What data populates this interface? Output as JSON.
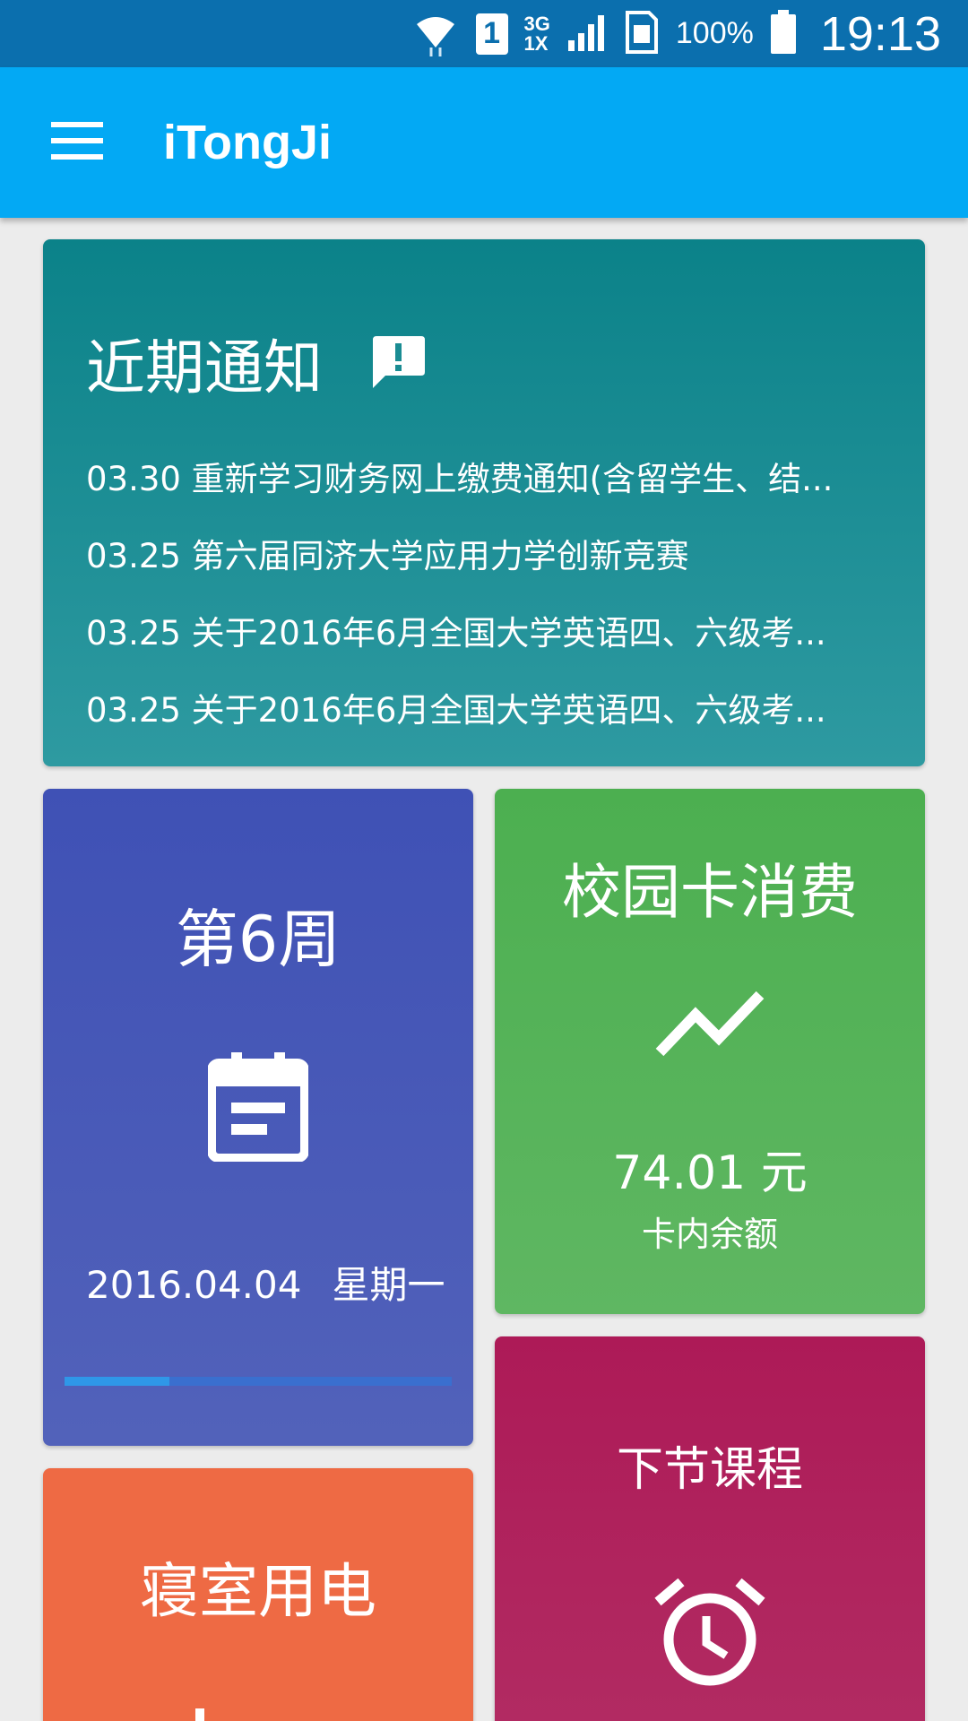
{
  "status_bar": {
    "sim_slot": "1",
    "network_type_top": "3G",
    "network_type_bottom": "1X",
    "battery_percent": "100%",
    "time": "19:13",
    "icons": [
      "wifi-icon",
      "sim-icon",
      "signal-icon",
      "sim-card-icon",
      "battery-icon"
    ]
  },
  "app_bar": {
    "title": "iTongJi",
    "background_color": "#03a9f4",
    "menu_icon": "menu-icon"
  },
  "notice_card": {
    "title": "近期通知",
    "icon": "feedback-icon",
    "items": [
      "03.30 重新学习财务网上缴费通知(含留学生、结...",
      "03.25 第六届同济大学应用力学创新竞赛",
      "03.25 关于2016年6月全国大学英语四、六级考...",
      "03.25 关于2016年6月全国大学英语四、六级考..."
    ]
  },
  "week_card": {
    "title": "第6周",
    "icon": "calendar-icon",
    "date": "2016.04.04",
    "weekday": "星期一",
    "week_progress": 0.27
  },
  "campus_card": {
    "title": "校园卡消费",
    "icon": "trending-up-icon",
    "amount": "74.01 元",
    "subtitle": "卡内余额"
  },
  "course_card": {
    "title": "下节课程",
    "icon": "alarm-icon"
  },
  "power_card": {
    "title": "寝室用电"
  }
}
